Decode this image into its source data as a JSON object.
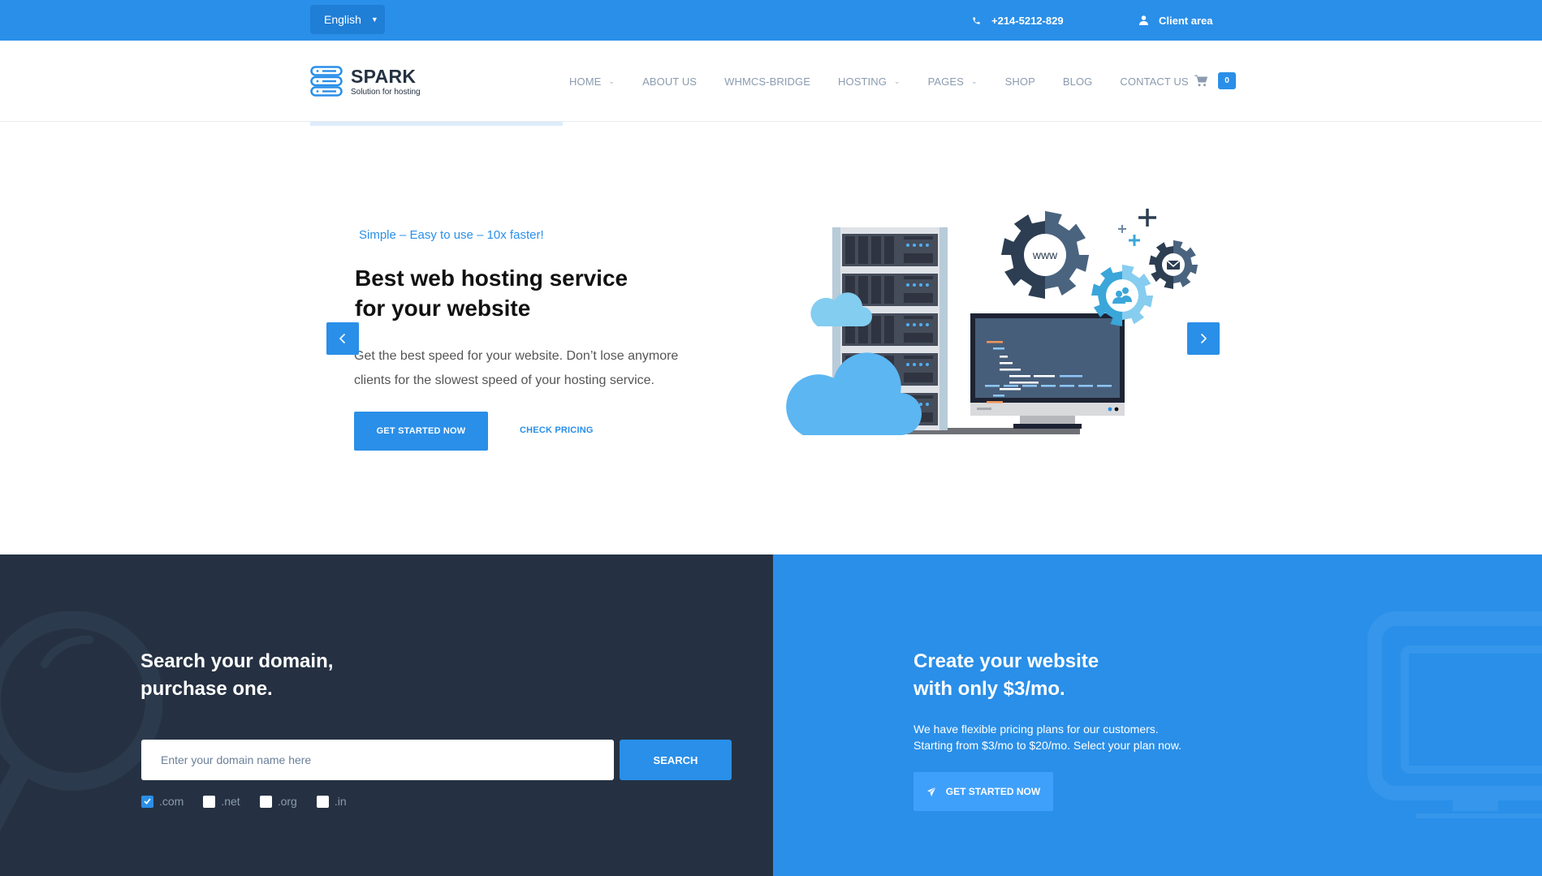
{
  "topbar": {
    "language": "English",
    "phone": "+214-5212-829",
    "client_area": "Client area"
  },
  "header": {
    "logo_title": "SPARK",
    "logo_subtitle": "Solution for hosting",
    "nav": [
      {
        "label": "HOME",
        "dropdown": true
      },
      {
        "label": "ABOUT US",
        "dropdown": false
      },
      {
        "label": "WHMCS-BRIDGE",
        "dropdown": false
      },
      {
        "label": "HOSTING",
        "dropdown": true
      },
      {
        "label": "PAGES",
        "dropdown": true
      },
      {
        "label": "SHOP",
        "dropdown": false
      },
      {
        "label": "BLOG",
        "dropdown": false
      },
      {
        "label": "CONTACT US",
        "dropdown": false
      }
    ],
    "cart_count": "0"
  },
  "hero": {
    "tagline": "Simple – Easy to use – 10x faster!",
    "title_line1": "Best web hosting service",
    "title_line2": "for your website",
    "text_line1": "Get the best speed for your website. Don’t lose anymore",
    "text_line2": "clients for the slowest speed of your hosting service.",
    "primary_button": "GET STARTED NOW",
    "secondary_link": "CHECK PRICING",
    "illustration_gear_label": "www"
  },
  "domain_search": {
    "title_line1": "Search your domain,",
    "title_line2": "purchase one.",
    "placeholder": "Enter your domain name here",
    "value": "",
    "search_button": "SEARCH",
    "tlds": [
      {
        "label": ".com",
        "checked": true
      },
      {
        "label": ".net",
        "checked": false
      },
      {
        "label": ".org",
        "checked": false
      },
      {
        "label": ".in",
        "checked": false
      }
    ]
  },
  "promo": {
    "title_line1": "Create your website",
    "title_line2": "with only $3/mo.",
    "text_line1": "We have flexible pricing plans for our customers.",
    "text_line2": "Starting from $3/mo to $20/mo. Select your plan now.",
    "button": "GET STARTED NOW"
  },
  "colors": {
    "brand_blue": "#2a8fe8",
    "dark_navy": "#253142",
    "nav_gray": "#8b9bb0"
  }
}
